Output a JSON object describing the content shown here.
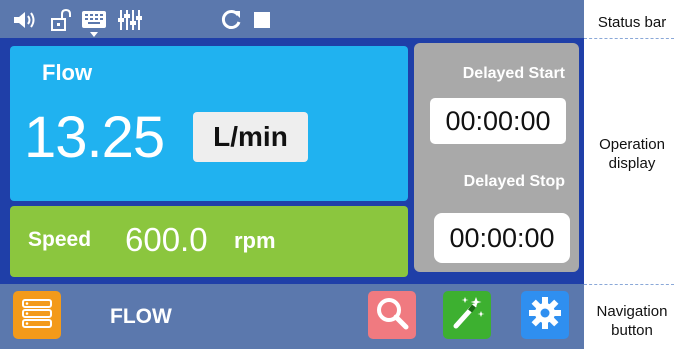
{
  "status_bar": {
    "icons": [
      "speaker-icon",
      "unlocked-padlock-icon",
      "keyboard-icon",
      "sliders-icon",
      "refresh-icon",
      "stop-square-icon"
    ]
  },
  "operation": {
    "flow": {
      "label": "Flow",
      "value": "13.25",
      "unit": "L/min"
    },
    "speed": {
      "label": "Speed",
      "value": "600.0",
      "unit": "rpm"
    },
    "delayed_start": {
      "label": "Delayed Start",
      "time": "00:00:00"
    },
    "delayed_stop": {
      "label": "Delayed Stop",
      "time": "00:00:00"
    }
  },
  "navigation": {
    "title": "FLOW",
    "buttons": [
      "menu-list-icon",
      "search-icon",
      "magic-wand-icon",
      "gear-icon"
    ]
  },
  "annotations": {
    "status_bar": "Status bar",
    "operation_display_line1": "Operation",
    "operation_display_line2": "display",
    "navigation_button_line1": "Navigation",
    "navigation_button_line2": "button"
  },
  "colors": {
    "screen_bg": "#1f3fa8",
    "bar_bg": "#5b78ad",
    "flow_panel": "#20b2f0",
    "speed_panel": "#8bc63e",
    "delay_panel": "#a9a9a9",
    "menu_button": "#f39a1a",
    "search_button": "#f07a80",
    "wand_button": "#3db030",
    "gear_button": "#2f8ff0"
  }
}
